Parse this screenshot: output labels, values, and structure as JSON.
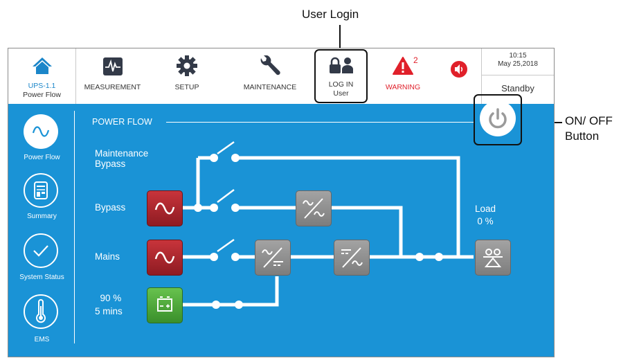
{
  "annotations": {
    "user_login": "User Login",
    "on_off_line1": "ON/ OFF",
    "on_off_line2": "Button"
  },
  "topbar": {
    "home": {
      "line1": "UPS-1.1",
      "line2": "Power Flow"
    },
    "measurement": "MEASUREMENT",
    "setup": "SETUP",
    "maintenance": "MAINTENANCE",
    "login": {
      "line1": "LOG IN",
      "line2": "User"
    },
    "warning": {
      "label": "WARNING",
      "count": "2"
    },
    "clock": {
      "time": "10:15",
      "date": "May 25,2018"
    },
    "status": "Standby"
  },
  "sidebar": {
    "items": [
      {
        "label": "Power Flow",
        "icon": "sine-wave-icon",
        "active": true
      },
      {
        "label": "Summary",
        "icon": "summary-icon",
        "active": false
      },
      {
        "label": "System Status",
        "icon": "checkmark-icon",
        "active": false
      },
      {
        "label": "EMS",
        "icon": "thermometer-icon",
        "active": false
      }
    ]
  },
  "power_flow": {
    "title": "POWER FLOW",
    "labels": {
      "maintenance_bypass_1": "Maintenance",
      "maintenance_bypass_2": "Bypass",
      "bypass": "Bypass",
      "mains": "Mains",
      "battery_charge": "90 %",
      "battery_runtime": "5 mins",
      "load_title": "Load",
      "load_value": "0 %"
    }
  },
  "colors": {
    "panel_blue": "#1a93d6",
    "icon_blue": "#1b86c9",
    "source_red": "#b4252d",
    "battery_green": "#4cae3a",
    "module_gray": "#8f8f8f",
    "warning_red": "#e0202a"
  }
}
